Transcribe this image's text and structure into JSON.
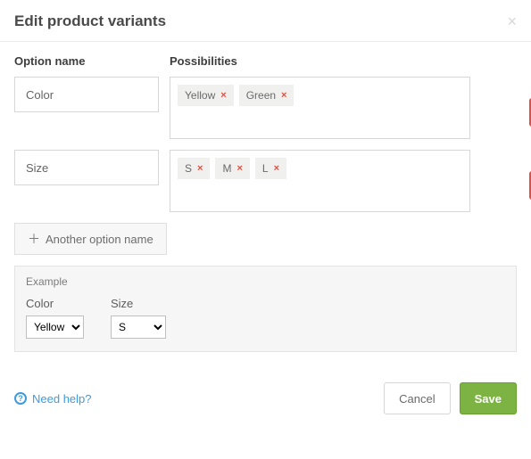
{
  "modal": {
    "title": "Edit product variants",
    "headers": {
      "name": "Option name",
      "possibilities": "Possibilities"
    },
    "add_button": "Another option name",
    "help_label": "Need help?",
    "cancel_label": "Cancel",
    "save_label": "Save"
  },
  "options": [
    {
      "name": "Color",
      "tags": [
        "Yellow",
        "Green"
      ]
    },
    {
      "name": "Size",
      "tags": [
        "S",
        "M",
        "L"
      ]
    }
  ],
  "example": {
    "label": "Example",
    "fields": [
      {
        "label": "Color",
        "selected": "Yellow"
      },
      {
        "label": "Size",
        "selected": "S"
      }
    ]
  },
  "colors": {
    "danger": "#e74c3c",
    "success": "#7CB342",
    "link": "#3e9bdc"
  }
}
